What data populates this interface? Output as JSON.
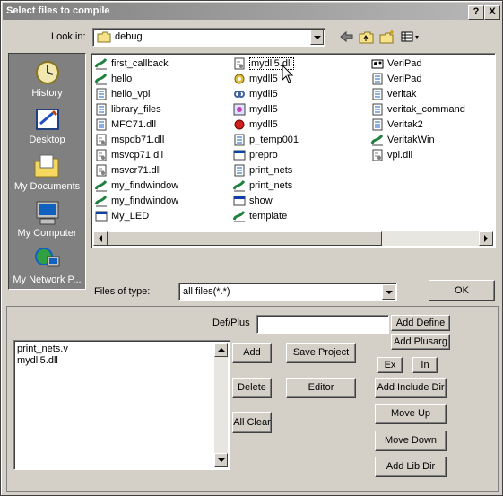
{
  "window": {
    "title": "Select files to compile",
    "help_button": "?",
    "close_button": "X"
  },
  "lookin": {
    "label": "Look in:",
    "value": "debug"
  },
  "places": [
    {
      "label": "History"
    },
    {
      "label": "Desktop"
    },
    {
      "label": "My Documents"
    },
    {
      "label": "My Computer"
    },
    {
      "label": "My Network P..."
    }
  ],
  "files": {
    "col1": [
      "first_callback",
      "hello",
      "hello_vpi",
      "library_files",
      "MFC71.dll",
      "mspdb71.dll",
      "msvcp71.dll",
      "msvcr71.dll",
      "my_findwindow",
      "my_findwindow",
      "My_LED"
    ],
    "col2": [
      "mydll5.dll",
      "mydll5",
      "mydll5",
      "mydll5",
      "mydll5",
      "p_temp001",
      "prepro",
      "print_nets",
      "print_nets",
      "show",
      "template"
    ],
    "col3": [
      "VeriPad",
      "VeriPad",
      "veritak",
      "veritak_command",
      "Veritak2",
      "VeritakWin",
      "vpi.dll"
    ]
  },
  "filetype": {
    "label": "Files of type:",
    "value": "all files(*.*)"
  },
  "buttons": {
    "ok": "OK",
    "add_define": "Add Define",
    "add_plusarg": "Add Plusarg",
    "add": "Add",
    "save_project": "Save Project",
    "ex": "Ex",
    "in": "In",
    "delete": "Delete",
    "editor": "Editor",
    "add_include_dir": "Add Include Dir",
    "all_clear": "All Clear",
    "move_up": "Move Up",
    "move_down": "Move Down",
    "add_lib_dir": "Add Lib Dir"
  },
  "defplus": {
    "label": "Def/Plus",
    "value": ""
  },
  "selected_files": [
    "print_nets.v",
    "mydll5.dll"
  ]
}
